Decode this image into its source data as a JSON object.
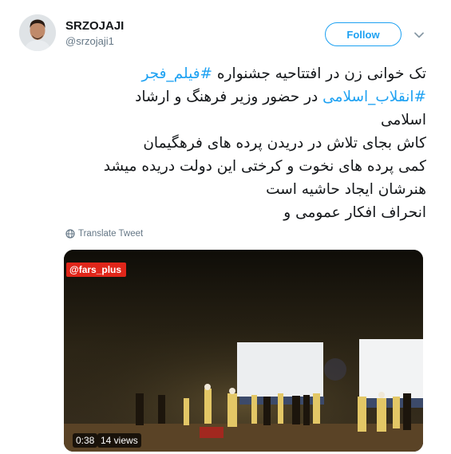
{
  "author": {
    "display_name": "SRZOJAJI",
    "handle": "@srzojaji1"
  },
  "follow_label": "Follow",
  "tweet": {
    "lines": [
      [
        {
          "text": "تک خوانی زن در افتتاحیه جشنواره ",
          "hashtag": false
        },
        {
          "text": "#فیلم_فجر",
          "hashtag": true
        }
      ],
      [
        {
          "text": "#انقلاب_اسلامی",
          "hashtag": true
        },
        {
          "text": " در حضور وزیر فرهنگ و ارشاد",
          "hashtag": false
        }
      ],
      [
        {
          "text": "اسلامی",
          "hashtag": false
        }
      ],
      [
        {
          "text": "کاش بجای تلاش در دریدن پرده های فرهگیمان",
          "hashtag": false
        }
      ],
      [
        {
          "text": "کمی پرده های نخوت و کرختی این دولت دریده میشد",
          "hashtag": false
        }
      ],
      [
        {
          "text": "هنرشان ایجاد حاشیه است",
          "hashtag": false
        }
      ],
      [
        {
          "text": "انحراف افکار عمومی و",
          "hashtag": false
        }
      ]
    ]
  },
  "translate_label": "Translate Tweet",
  "video": {
    "watermark": "@fars_plus",
    "duration": "0:38",
    "views": "14 views"
  },
  "colors": {
    "link": "#1da1f2",
    "text": "#14171a",
    "muted": "#657786",
    "watermark_bg": "#e0261a"
  },
  "icons": [
    "caret-down-icon",
    "globe-icon"
  ]
}
